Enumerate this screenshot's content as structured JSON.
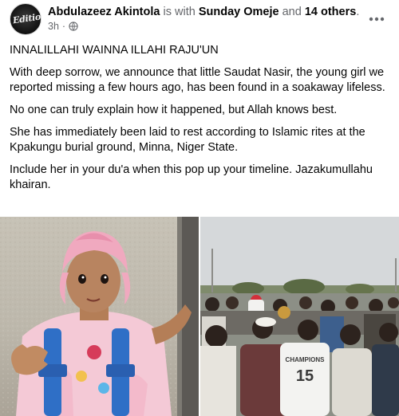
{
  "post": {
    "author": "Abdulazeez Akintola",
    "with_text": "is with",
    "tagged_person": "Sunday Omeje",
    "and_text": "and",
    "others": "14 others",
    "period": ".",
    "time": "3h",
    "dot": "·",
    "privacy_icon": "globe-icon",
    "avatar_text": "Edition",
    "paragraphs": [
      "INNALILLAHI WAINNA ILLAHI RAJU'UN",
      "With deep sorrow, we announce that little Saudat Nasir, the young girl we reported missing a few hours ago, has been found in a soakaway lifeless.",
      "No one can truly explain how it happened, but Allah knows best.",
      "She has immediately been laid to rest according to Islamic rites at the Kpakungu burial ground, Minna, Niger State.",
      "Include her in your du'a when this pop up your timeline. Jazakumullahu khairan."
    ]
  },
  "photos": {
    "right_shirt_text": "CHAMPIONS",
    "right_shirt_number": "15"
  },
  "colors": {
    "text": "#050505",
    "muted": "#65676b",
    "hijab": "#f0a9bf",
    "backpack": "#2f6fc6"
  }
}
